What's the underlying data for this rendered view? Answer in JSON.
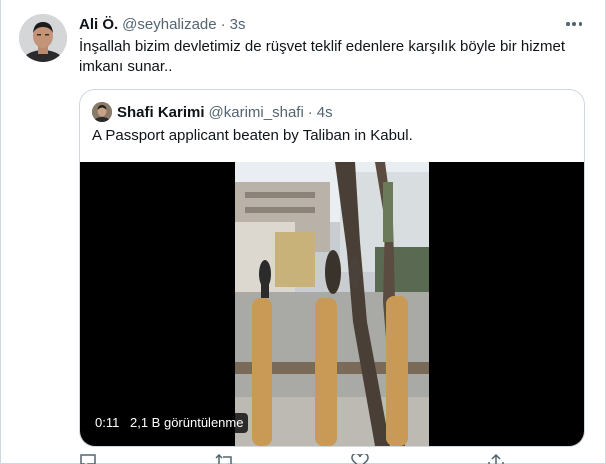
{
  "tweet": {
    "author_name": "Ali Ö.",
    "author_handle": "@seyhalizade",
    "separator": "·",
    "time": "3s",
    "text": "İnşallah bizim devletimiz de rüşvet teklif edenlere karşılık böyle bir hizmet imkanı sunar.."
  },
  "quoted": {
    "author_name": "Shafi Karimi",
    "author_handle": "@karimi_shafi",
    "separator": "·",
    "time": "4s",
    "text": "A Passport applicant beaten by Taliban in Kabul."
  },
  "video": {
    "duration": "0:11",
    "views": "2,1 B görüntülenme"
  },
  "icons": {
    "more": "more-horizontal-icon",
    "reply": "reply-icon",
    "retweet": "retweet-icon",
    "like": "like-icon",
    "share": "share-icon"
  },
  "colors": {
    "text": "#0f1419",
    "secondary": "#536471",
    "border": "#cfd9de"
  }
}
